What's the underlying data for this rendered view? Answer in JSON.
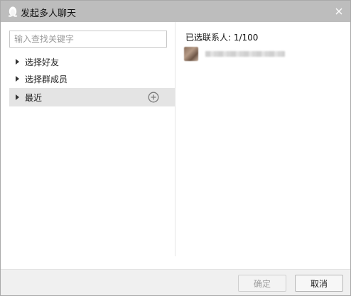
{
  "window": {
    "title": "发起多人聊天",
    "icon": "penguin-icon",
    "close_icon": "close-icon"
  },
  "search": {
    "placeholder": "输入查找关键字",
    "value": ""
  },
  "tree": {
    "items": [
      {
        "label": "选择好友",
        "expanded": false,
        "selected": false
      },
      {
        "label": "选择群成员",
        "expanded": false,
        "selected": false
      },
      {
        "label": "最近",
        "expanded": false,
        "selected": true,
        "action_icon": "add-circle-icon"
      }
    ]
  },
  "selection": {
    "label": "已选联系人: 1/100",
    "count": 1,
    "max": 100
  },
  "buttons": {
    "confirm_label": "确定",
    "confirm_enabled": false,
    "cancel_label": "取消"
  },
  "colors": {
    "titlebar": "#bdbdbd",
    "selected_row": "#e4e4e4",
    "footer": "#f0f0f0"
  }
}
